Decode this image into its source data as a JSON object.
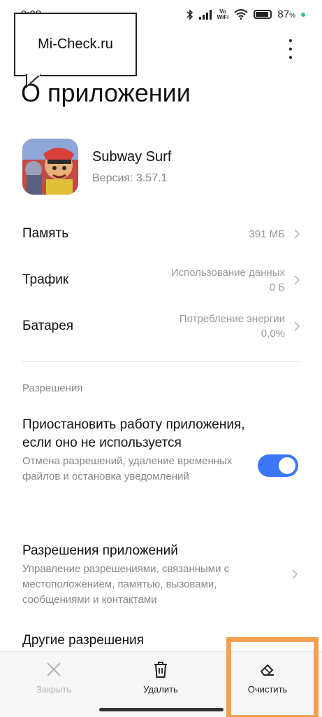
{
  "status_bar": {
    "time": "9:08",
    "vowifi": "Vo WiFi",
    "battery_percent": "87",
    "percent_sign": "%"
  },
  "watermark": {
    "text": "Mi-Check.ru"
  },
  "page_title": "О приложении",
  "app": {
    "name": "Subway Surf",
    "version": "Версия: 3.57.1"
  },
  "info_rows": {
    "memory": {
      "label": "Память",
      "value": "391 МБ"
    },
    "traffic": {
      "label": "Трафик",
      "value_line1": "Использование данных",
      "value_line2": "0 Б"
    },
    "battery": {
      "label": "Батарея",
      "value_line1": "Потребление энергии",
      "value_line2": "0,0%"
    }
  },
  "permissions": {
    "section_title": "Разрешения",
    "pause_app": {
      "title": "Приостановить работу приложения, если оно не используется",
      "subtitle": "Отмена разрешений, удаление временных файлов и остановка уведомлений",
      "enabled": true
    },
    "app_permissions": {
      "title": "Разрешения приложений",
      "subtitle": "Управление разрешениями, связанными с местоположением, памятью, вызовами, сообщениями и контактами"
    },
    "other_permissions": {
      "title": "Другие разрешения"
    }
  },
  "bottom_bar": {
    "close_label": "Закрыть",
    "delete_label": "Удалить",
    "clear_label": "Очистить"
  },
  "colors": {
    "accent": "#3b76f6",
    "highlight": "#f5a050"
  },
  "icons": {
    "menu": "more-vertical-icon",
    "chevron": "chevron-right-icon",
    "close": "close-x-icon",
    "delete": "trash-icon",
    "clear": "eraser-icon"
  }
}
